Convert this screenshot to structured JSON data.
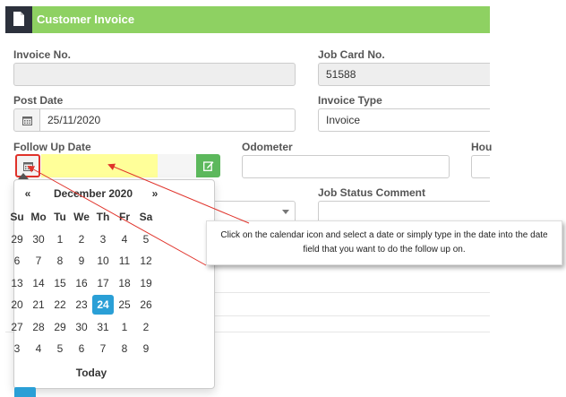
{
  "header": {
    "title": "Customer Invoice"
  },
  "form": {
    "invoice_no_label": "Invoice No.",
    "invoice_no_value": "",
    "job_card_label": "Job Card No.",
    "job_card_value": "51588",
    "post_date_label": "Post Date",
    "post_date_value": "25/11/2020",
    "invoice_type_label": "Invoice Type",
    "invoice_type_value": "Invoice",
    "follow_up_label": "Follow Up Date",
    "follow_up_value": "",
    "odometer_label": "Odometer",
    "odometer_value": "",
    "hours_label": "Hou",
    "job_status_label": "Job Status Comment"
  },
  "datepicker": {
    "prev": "«",
    "next": "»",
    "month": "December 2020",
    "weekdays": [
      "Su",
      "Mo",
      "Tu",
      "We",
      "Th",
      "Fr",
      "Sa"
    ],
    "weeks": [
      [
        "29",
        "30",
        "1",
        "2",
        "3",
        "4",
        "5"
      ],
      [
        "6",
        "7",
        "8",
        "9",
        "10",
        "11",
        "12"
      ],
      [
        "13",
        "14",
        "15",
        "16",
        "17",
        "18",
        "19"
      ],
      [
        "20",
        "21",
        "22",
        "23",
        "24",
        "25",
        "26"
      ],
      [
        "27",
        "28",
        "29",
        "30",
        "31",
        "1",
        "2"
      ],
      [
        "3",
        "4",
        "5",
        "6",
        "7",
        "8",
        "9"
      ]
    ],
    "today_label": "Today",
    "selected_day": "24"
  },
  "callout": {
    "text": "Click on the calendar icon and select a date or simply type in the date into the date field that you want to do the follow up on."
  },
  "colors": {
    "header_green": "#8ed162",
    "header_dark": "#2c313c",
    "highlight_yellow": "#ffff99",
    "arrow_red": "#e0322a",
    "today_blue": "#2a9fd6",
    "button_green": "#5cb85c"
  },
  "icons": {
    "header": "document-icon",
    "post_date": "calendar-icon",
    "follow_up": "calendar-icon",
    "edit": "edit-icon",
    "select_caret": "caret-down-icon"
  }
}
